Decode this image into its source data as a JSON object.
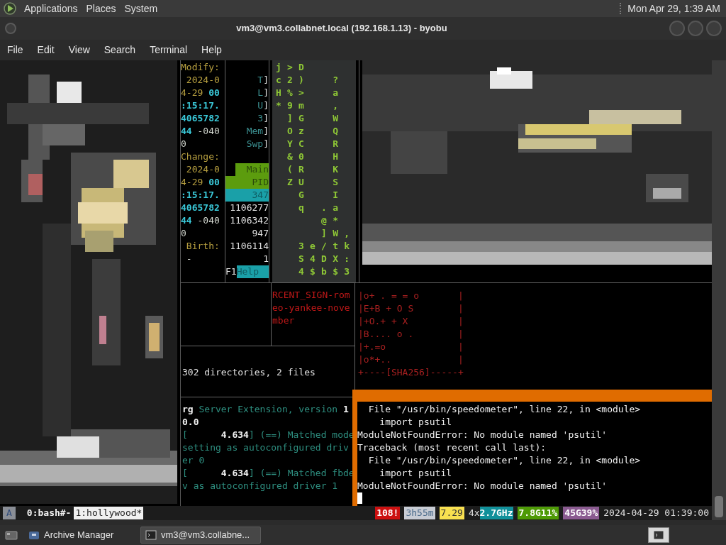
{
  "top_panel": {
    "menus": [
      "Applications",
      "Places",
      "System"
    ],
    "clock": "Mon Apr 29, 1:39 AM"
  },
  "window": {
    "title": "vm3@vm3.collabnet.local (192.168.1.13) - byobu"
  },
  "menu_bar": [
    "File",
    "Edit",
    "View",
    "Search",
    "Terminal",
    "Help"
  ],
  "stat_pane": [
    [
      {
        "text": "Modify:",
        "kind": "label"
      }
    ],
    [
      {
        "text": " 2024-0",
        "kind": "label"
      }
    ],
    [
      {
        "text": "4-29 ",
        "kind": "label"
      },
      {
        "text": "00",
        "kind": "value"
      }
    ],
    [
      {
        "text": ":15:17.",
        "kind": "value"
      }
    ],
    [
      {
        "text": "4065782",
        "kind": "value"
      }
    ],
    [
      {
        "text": "44",
        "kind": "value"
      },
      {
        "text": " -040",
        "kind": "plain"
      }
    ],
    [
      {
        "text": "0",
        "kind": "plain"
      }
    ],
    [
      {
        "text": "Change:",
        "kind": "label"
      }
    ],
    [
      {
        "text": " 2024-0",
        "kind": "label"
      }
    ],
    [
      {
        "text": "4-29 ",
        "kind": "label"
      },
      {
        "text": "00",
        "kind": "value"
      }
    ],
    [
      {
        "text": ":15:17.",
        "kind": "value"
      }
    ],
    [
      {
        "text": "4065782",
        "kind": "value"
      }
    ],
    [
      {
        "text": "44",
        "kind": "value"
      },
      {
        "text": " -040",
        "kind": "plain"
      }
    ],
    [
      {
        "text": "0",
        "kind": "plain"
      }
    ],
    [
      {
        "text": " Birth:",
        "kind": "label"
      }
    ],
    [
      {
        "text": " -",
        "kind": "plain"
      }
    ]
  ],
  "htop_pane": [
    {
      "kind": "spacer"
    },
    {
      "kind": "line",
      "segments": [
        {
          "text": "T",
          "kind": "meter"
        },
        {
          "text": "]",
          "kind": "plain"
        }
      ]
    },
    {
      "kind": "line",
      "segments": [
        {
          "text": "L",
          "kind": "meter"
        },
        {
          "text": "]",
          "kind": "plain"
        }
      ]
    },
    {
      "kind": "line",
      "segments": [
        {
          "text": "U",
          "kind": "meter"
        },
        {
          "text": "]",
          "kind": "plain"
        }
      ]
    },
    {
      "kind": "line",
      "segments": [
        {
          "text": "3",
          "kind": "meter"
        },
        {
          "text": "]",
          "kind": "plain"
        }
      ]
    },
    {
      "kind": "line",
      "segments": [
        {
          "text": "Mem",
          "kind": "meter"
        },
        {
          "text": "]",
          "kind": "plain"
        }
      ]
    },
    {
      "kind": "line",
      "segments": [
        {
          "text": "Swp",
          "kind": "meter"
        },
        {
          "text": "]",
          "kind": "plain"
        }
      ]
    },
    {
      "kind": "spacer"
    },
    {
      "kind": "line",
      "segments": [
        {
          "text": "Main",
          "kind": "tab"
        }
      ]
    },
    {
      "kind": "header",
      "segments": [
        {
          "text": "PID",
          "kind": "header"
        }
      ]
    },
    {
      "kind": "selected",
      "segments": [
        {
          "text": "347",
          "kind": "selected"
        }
      ]
    },
    {
      "kind": "line",
      "segments": [
        {
          "text": "1106277",
          "kind": "plain"
        }
      ]
    },
    {
      "kind": "line",
      "segments": [
        {
          "text": "1106342",
          "kind": "plain"
        }
      ]
    },
    {
      "kind": "line",
      "segments": [
        {
          "text": "947",
          "kind": "plain"
        }
      ]
    },
    {
      "kind": "line",
      "segments": [
        {
          "text": "1106114",
          "kind": "plain"
        }
      ]
    },
    {
      "kind": "line",
      "segments": [
        {
          "text": "1",
          "kind": "plain"
        }
      ]
    },
    {
      "kind": "footer",
      "segments": [
        {
          "text": "F1",
          "kind": "plain"
        },
        {
          "text": "Help",
          "kind": "selected"
        }
      ]
    }
  ],
  "matrix_rows": [
    "j>D    ",
    "c2)  ? ",
    "H%>  a ",
    "*9m  , ",
    " ]G  W ",
    " Oz  Q ",
    " YC  R ",
    " &0  H ",
    " (R  K ",
    " ZU  S ",
    "  G  I ",
    "  q .a ",
    "    @* ",
    "    ]W,",
    "  3e/tk",
    "  S4DX:",
    "  4$b$3"
  ],
  "red_pane": [
    "RCENT_SIGN-rom",
    "eo-yankee-nove",
    "mber"
  ],
  "tree_pane": "302 directories, 2 files",
  "key_art": [
    "|o+ . = = o       |",
    "|E+B + O S        |",
    "|+O.+ + X         |",
    "|B.... o .        |",
    "|+.=o             |",
    "|o*+..            |",
    "+----[SHA256]-----+"
  ],
  "xorg_pane": [
    [
      {
        "text": "rg",
        "kind": "bold"
      },
      {
        "text": " Server Extension, version ",
        "kind": "teal"
      },
      {
        "text": "1",
        "kind": "bold"
      }
    ],
    [
      {
        "text": "0.0",
        "kind": "bold"
      }
    ],
    [
      {
        "text": "[",
        "kind": "teal"
      },
      {
        "text": "      4.634",
        "kind": "bold"
      },
      {
        "text": "] (==) Matched mode",
        "kind": "teal"
      }
    ],
    [
      {
        "text": "setting as autoconfigured driv",
        "kind": "teal"
      }
    ],
    [
      {
        "text": "er 0",
        "kind": "teal"
      }
    ],
    [
      {
        "text": "[",
        "kind": "teal"
      },
      {
        "text": "      4.634",
        "kind": "bold"
      },
      {
        "text": "] (==) Matched fbde",
        "kind": "teal"
      }
    ],
    [
      {
        "text": "v as autoconfigured driver 1",
        "kind": "teal"
      }
    ]
  ],
  "active_pane": [
    "  File \"/usr/bin/speedometer\", line 22, in <module>",
    "    import psutil",
    "ModuleNotFoundError: No module named 'psutil'",
    "Traceback (most recent call last):",
    "  File \"/usr/bin/speedometer\", line 22, in <module>",
    "    import psutil",
    "ModuleNotFoundError: No module named 'psutil'"
  ],
  "status_bar": {
    "session": "A",
    "windows": [
      {
        "label": "0:bash#-",
        "selected": false
      },
      {
        "label": "1:hollywood*",
        "selected": true
      }
    ],
    "items": [
      {
        "text": "108!",
        "kind": "alert"
      },
      {
        "text": "3h55m",
        "kind": "uptime"
      },
      {
        "text": "7.29",
        "kind": "load"
      },
      {
        "text": "4x",
        "kind": "plain"
      },
      {
        "text": "2.7GHz",
        "kind": "cpu"
      },
      {
        "text": "7.8G11%",
        "kind": "memory"
      },
      {
        "text": "45G39%",
        "kind": "disk"
      },
      {
        "text": "2024-04-29 01:39:00",
        "kind": "plain"
      }
    ]
  },
  "taskbar": [
    {
      "label": "Archive Manager",
      "selected": false
    },
    {
      "label": "vm3@vm3.collabne...",
      "selected": true
    }
  ]
}
